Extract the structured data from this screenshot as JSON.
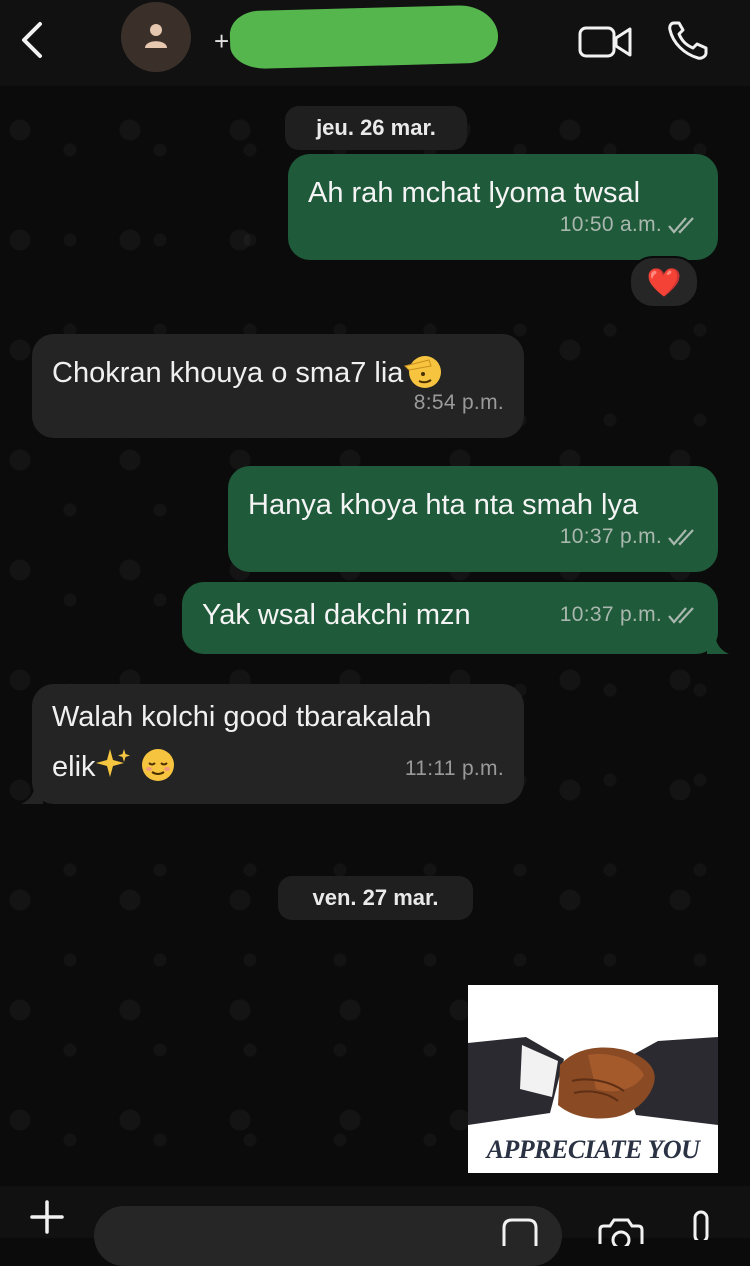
{
  "header": {
    "back_icon": "chevron-left-icon",
    "avatar_icon": "person-icon",
    "contact_prefix": "+",
    "video_icon": "video-camera-icon",
    "call_icon": "phone-icon"
  },
  "chat": {
    "date_1": "jeu. 26 mar.",
    "date_2": "ven. 27 mar.",
    "messages": [
      {
        "direction": "out",
        "text": "Ah rah mchat lyoma twsal",
        "time": "10:50 a.m."
      },
      {
        "direction": "in",
        "text": "Chokran khouya o sma7 lia",
        "time": "8:54 p.m."
      },
      {
        "direction": "out",
        "text": "Hanya khoya hta nta smah lya",
        "time": "10:37 p.m."
      },
      {
        "direction": "out",
        "text": "Yak wsal dakchi mzn",
        "time": "10:37 p.m."
      },
      {
        "direction": "in",
        "text_line1": "Walah kolchi good tbarakalah",
        "text_line2": "elik",
        "time": "11:11 p.m."
      }
    ],
    "reaction": "❤️",
    "image_caption": "APPRECIATE YOU"
  },
  "composer": {
    "plus_icon": "plus-icon",
    "sticker_icon": "sticker-icon",
    "camera_icon": "camera-icon",
    "mic_icon": "microphone-icon"
  },
  "colors": {
    "outgoing_bubble": "#1f5a3a",
    "incoming_bubble": "#242424",
    "background": "#0b0b0b",
    "redaction": "#55b64d"
  }
}
